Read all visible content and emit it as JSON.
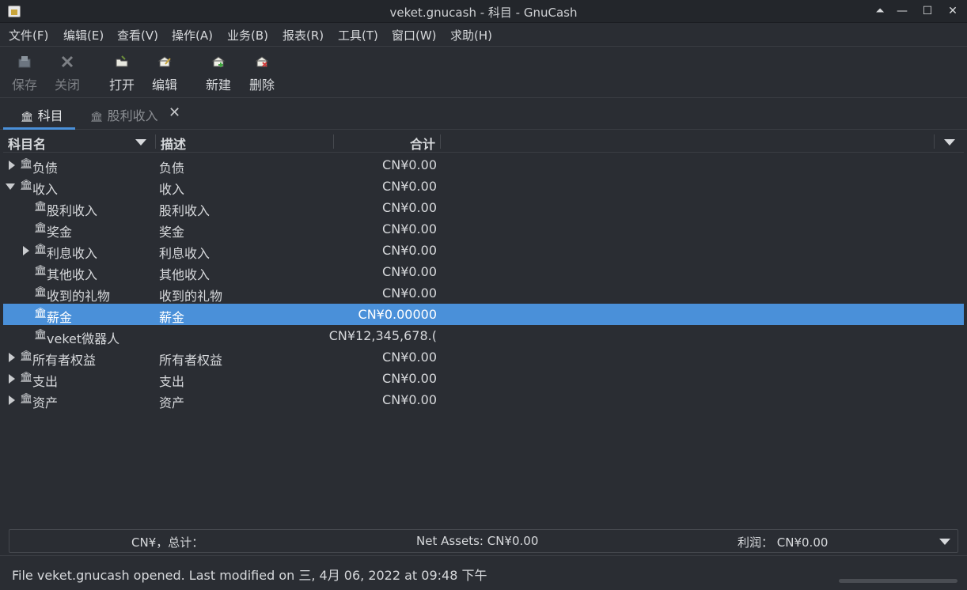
{
  "window": {
    "title": "veket.gnucash - 科目 - GnuCash"
  },
  "menu": [
    "文件(F)",
    "编辑(E)",
    "查看(V)",
    "操作(A)",
    "业务(B)",
    "报表(R)",
    "工具(T)",
    "窗口(W)",
    "求助(H)"
  ],
  "toolbar": {
    "save": "保存",
    "close": "关闭",
    "open": "打开",
    "edit": "编辑",
    "new": "新建",
    "delete": "删除"
  },
  "tabs": {
    "accounts": "科目",
    "dividend": "股利收入"
  },
  "columns": {
    "name": "科目名",
    "description": "描述",
    "total": "合计"
  },
  "rows": [
    {
      "name": "负债",
      "description": "负债",
      "total": "CN¥0.00"
    },
    {
      "name": "收入",
      "description": "收入",
      "total": "CN¥0.00"
    },
    {
      "name": "股利收入",
      "description": "股利收入",
      "total": "CN¥0.00"
    },
    {
      "name": "奖金",
      "description": "奖金",
      "total": "CN¥0.00"
    },
    {
      "name": "利息收入",
      "description": "利息收入",
      "total": "CN¥0.00"
    },
    {
      "name": "其他收入",
      "description": "其他收入",
      "total": "CN¥0.00"
    },
    {
      "name": "收到的礼物",
      "description": "收到的礼物",
      "total": "CN¥0.00"
    },
    {
      "name": "薪金",
      "description": "薪金",
      "total": "CN¥0.00000"
    },
    {
      "name": "veket微器人",
      "description": "",
      "total": "CN¥12,345,678.("
    },
    {
      "name": "所有者权益",
      "description": "所有者权益",
      "total": "CN¥0.00"
    },
    {
      "name": "支出",
      "description": "支出",
      "total": "CN¥0.00"
    },
    {
      "name": "资产",
      "description": "资产",
      "total": "CN¥0.00"
    }
  ],
  "summary": {
    "total_label": "CN¥，总计：",
    "net_assets": "Net Assets: CN¥0.00",
    "profit": "利润： CN¥0.00"
  },
  "status": {
    "text": "File veket.gnucash opened. Last modified on 三, 4月 06, 2022 at 09:48 下午"
  },
  "colors": {
    "selection": "#4a90d9",
    "background": "#2a2d33"
  }
}
